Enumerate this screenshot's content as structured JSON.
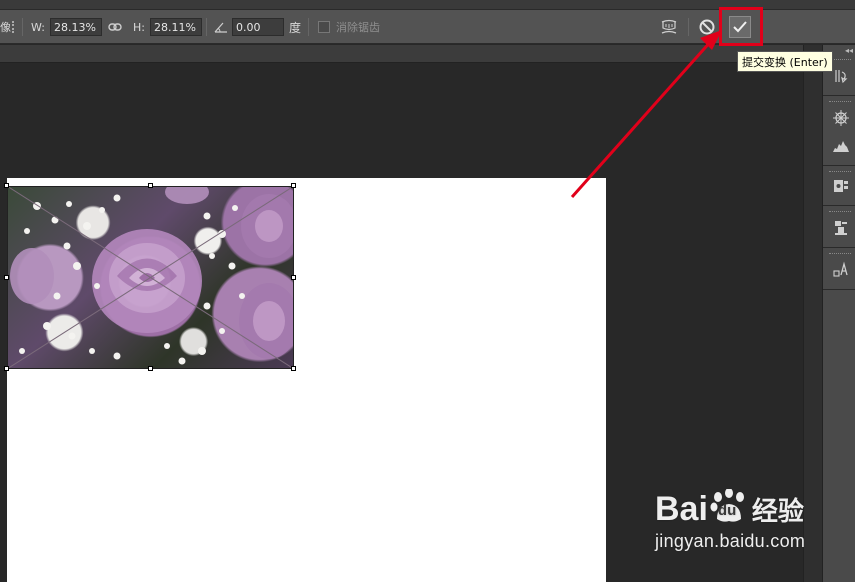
{
  "options_bar": {
    "truncated_label": "像",
    "w_label": "W:",
    "w_value": "28.13%",
    "h_label": "H:",
    "h_value": "28.11%",
    "angle_value": "0.00",
    "angle_unit": "度",
    "antialias_label": "消除锯齿",
    "warp_icon": "warp-mode-icon",
    "cancel_icon": "cancel-transform-icon",
    "commit_icon": "commit-checkmark-icon"
  },
  "tooltip": {
    "text": "提交变换 (Enter)"
  },
  "annotation": {
    "highlight_color": "#e1001a",
    "arrow_color": "#e1001a"
  },
  "right_panel": {
    "icons": [
      "history-icon",
      "navigator-icon",
      "histogram-icon",
      "properties-icon",
      "layer-comps-icon",
      "character-icon"
    ]
  },
  "watermark": {
    "logo_text": "Bai",
    "logo_paw": "du",
    "logo_cn": "经验",
    "url": "jingyan.baidu.com"
  }
}
